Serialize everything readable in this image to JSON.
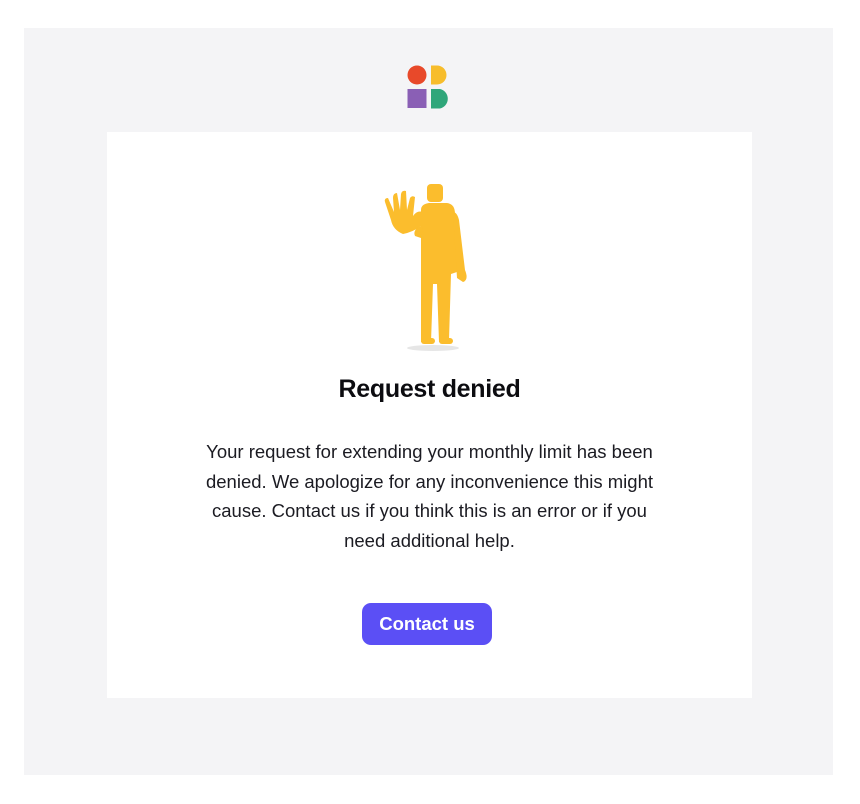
{
  "brand": {
    "logo_icon": "brand-logo-icon",
    "colors": {
      "red": "#e8492a",
      "yellow": "#f7bd2c",
      "purple": "#8a5fb5",
      "green": "#2fa67a"
    }
  },
  "illustration": {
    "icon": "stop-hand-person-illustration",
    "color": "#fbbd2d"
  },
  "content": {
    "title": "Request denied",
    "message": "Your request for extending your monthly limit has been denied. We apologize for any inconvenience this might cause. Contact us if you think this is an error or if you need additional help.",
    "cta_label": "Contact us"
  },
  "theme": {
    "background": "#f4f4f6",
    "card": "#ffffff",
    "accent": "#5b4ff5"
  }
}
